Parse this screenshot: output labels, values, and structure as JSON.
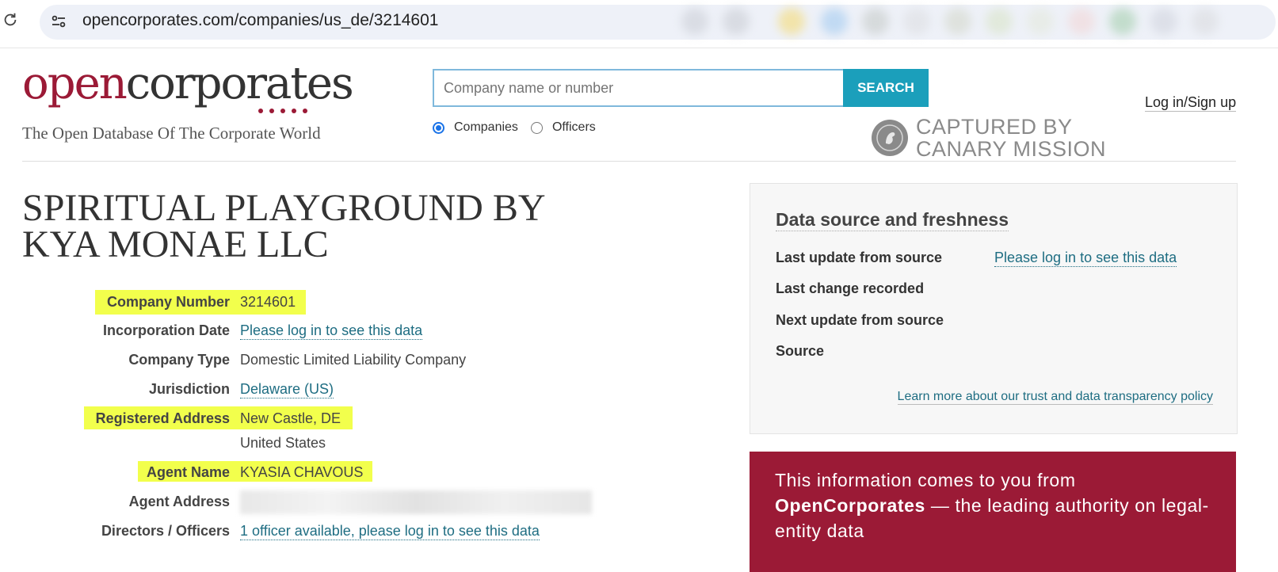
{
  "browser": {
    "url": "opencorporates.com/companies/us_de/3214601"
  },
  "header": {
    "logo_open": "open",
    "logo_corporates": "corporates",
    "tagline": "The Open Database Of The Corporate World",
    "search_placeholder": "Company name or number",
    "search_button": "SEARCH",
    "radio_companies": "Companies",
    "radio_officers": "Officers",
    "login": "Log in/Sign up",
    "overlay_line1": "CAPTURED BY",
    "overlay_line2": "CANARY MISSION"
  },
  "company": {
    "name": "SPIRITUAL PLAYGROUND BY KYA MONAE LLC",
    "fields": [
      {
        "label": "Company Number",
        "value": "3214601"
      },
      {
        "label": "Incorporation Date",
        "value": "Please log in to see this data"
      },
      {
        "label": "Company Type",
        "value": "Domestic Limited Liability Company"
      },
      {
        "label": "Jurisdiction",
        "value": "Delaware (US)"
      },
      {
        "label": "Registered Address",
        "value": "New Castle, DE",
        "value2": "United States"
      },
      {
        "label": "Agent Name",
        "value": "KYASIA CHAVOUS"
      },
      {
        "label": "Agent Address",
        "value": ""
      },
      {
        "label": "Directors / Officers",
        "value": "1 officer available, please log in to see this data"
      }
    ]
  },
  "panel": {
    "title": "Data source and freshness",
    "rows": [
      {
        "label": "Last update from source",
        "value": "Please log in to see this data"
      },
      {
        "label": "Last change recorded",
        "value": ""
      },
      {
        "label": "Next update from source",
        "value": ""
      },
      {
        "label": "Source",
        "value": ""
      }
    ],
    "footer_link": "Learn more about our trust and data transparency policy"
  },
  "promo": {
    "prefix": "This information comes to you from ",
    "brand": "OpenCorporates",
    "suffix": " — the leading authority on legal-entity data"
  },
  "colors": {
    "brand": "#9b1a36",
    "search_button": "#1b9fbb",
    "link": "#1e6d82",
    "highlight": "#f2ff4c"
  }
}
